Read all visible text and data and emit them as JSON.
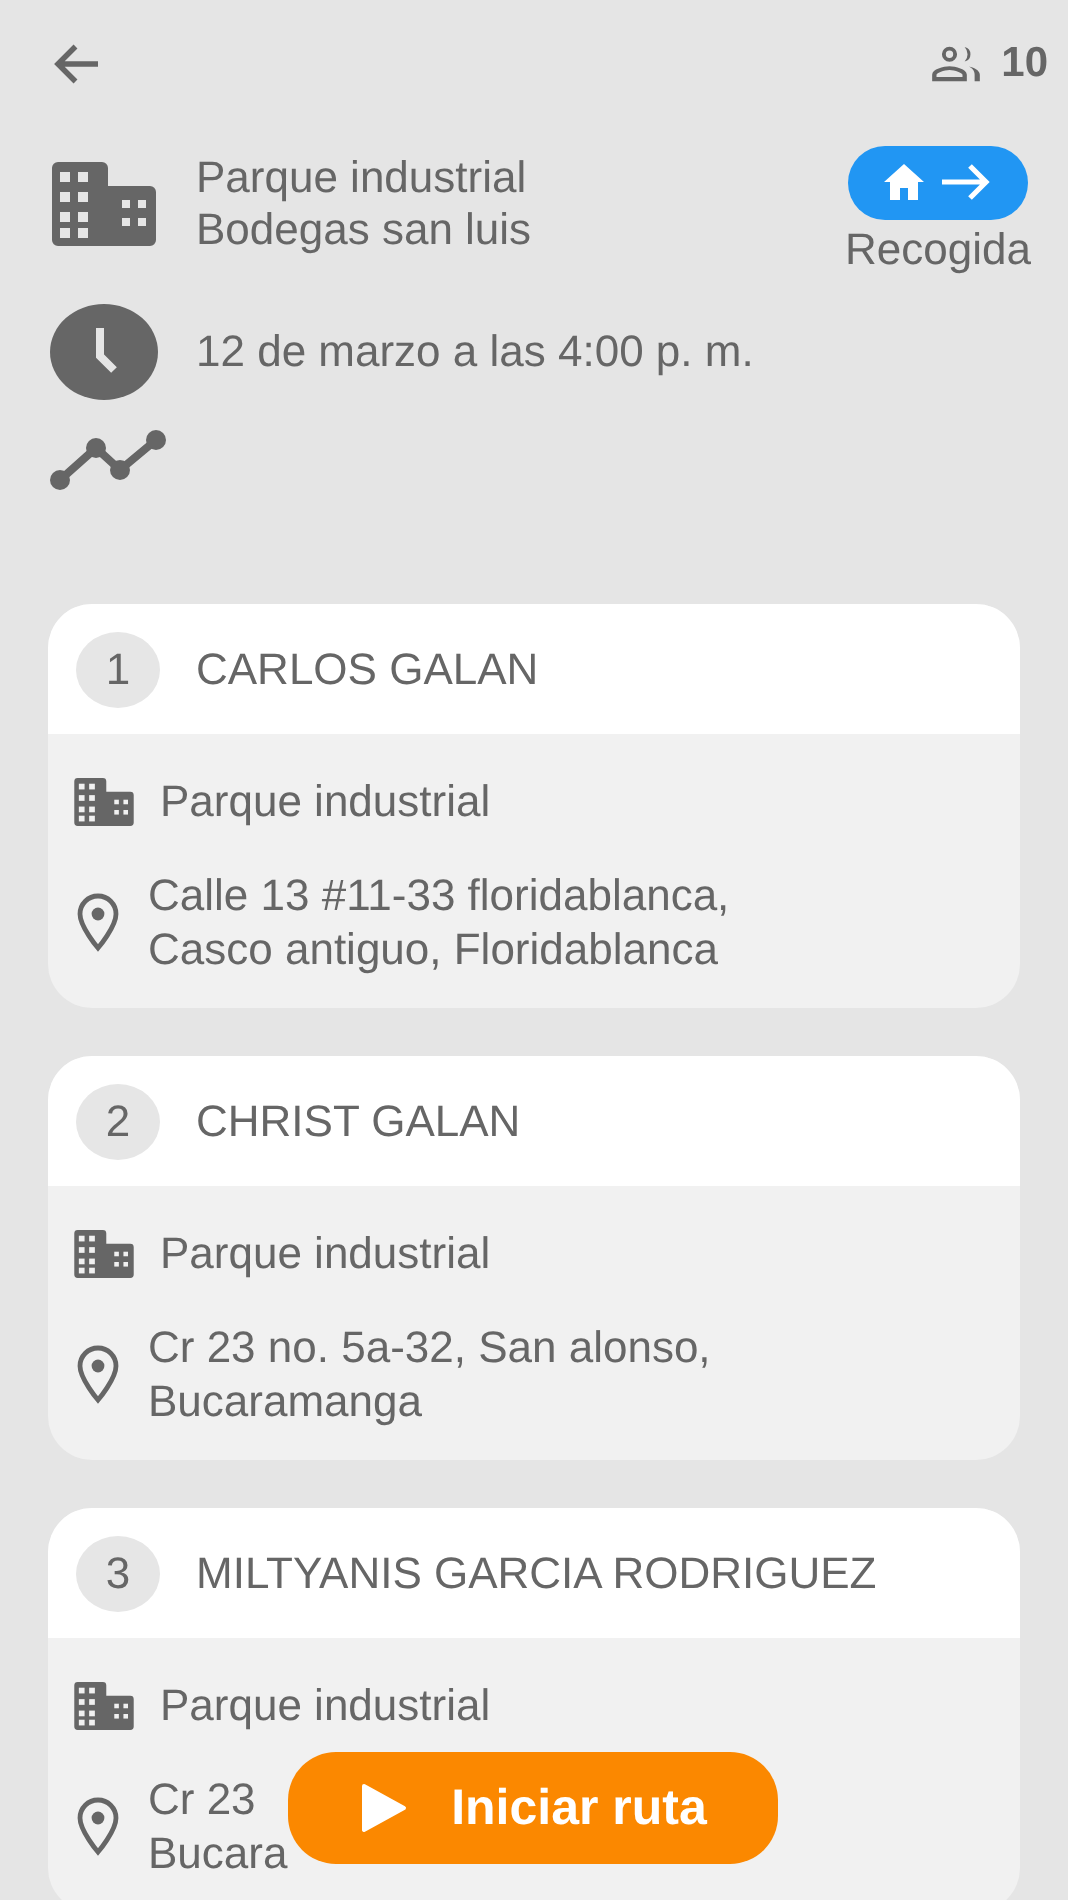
{
  "header": {
    "passenger_count": "10"
  },
  "place": {
    "lines": [
      "Parque industrial",
      "Bodegas san luis"
    ]
  },
  "trip_type": {
    "label": "Recogida"
  },
  "schedule": {
    "text": "12 de marzo a las 4:00 p. m."
  },
  "stops": [
    {
      "number": "1",
      "name": "CARLOS GALAN",
      "place": "Parque industrial",
      "address": [
        "Calle 13 #11-33 floridablanca,",
        "Casco antiguo, Floridablanca"
      ]
    },
    {
      "number": "2",
      "name": "CHRIST GALAN",
      "place": "Parque industrial",
      "address": [
        "Cr 23 no. 5a-32, San alonso,",
        "Bucaramanga"
      ]
    },
    {
      "number": "3",
      "name": "MILTYANIS GARCIA RODRIGUEZ",
      "place": "Parque industrial",
      "address": [
        "Cr 23",
        "Bucara"
      ]
    }
  ],
  "start_button": {
    "label": "Iniciar ruta"
  }
}
